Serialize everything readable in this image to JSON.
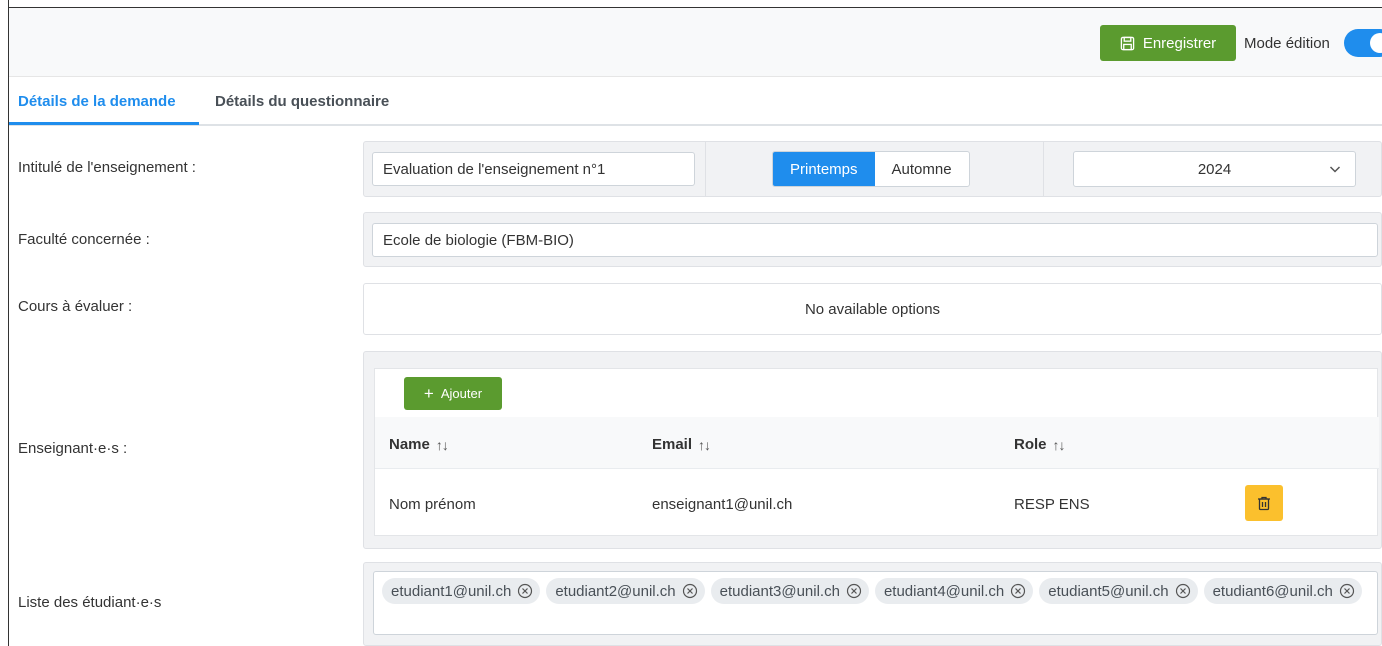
{
  "toolbar": {
    "save_label": "Enregistrer",
    "mode_label": "Mode édition",
    "mode_enabled": true,
    "save_icon": "floppy-disk-icon"
  },
  "tabs": [
    {
      "label": "Détails de la demande",
      "active": true
    },
    {
      "label": "Détails du questionnaire",
      "active": false
    }
  ],
  "form": {
    "intitule": {
      "label": "Intitulé de l'enseignement :",
      "value": "Evaluation de l'enseignement n°1",
      "semester_options": [
        "Printemps",
        "Automne"
      ],
      "semester_selected": "Printemps",
      "year": "2024"
    },
    "faculte": {
      "label": "Faculté concernée :",
      "value": "Ecole de biologie (FBM-BIO)"
    },
    "cours": {
      "label": "Cours à évaluer :",
      "empty_text": "No available options"
    },
    "enseignants": {
      "label": "Enseignant·e·s :",
      "add_label": "Ajouter",
      "columns": [
        "Name",
        "Email",
        "Role"
      ],
      "sort_glyph": "↑↓",
      "rows": [
        {
          "name": "Nom prénom",
          "email": "enseignant1@unil.ch",
          "role": "RESP ENS"
        }
      ]
    },
    "etudiants": {
      "label": "Liste des étudiant·e·s",
      "emails": [
        "etudiant1@unil.ch",
        "etudiant2@unil.ch",
        "etudiant3@unil.ch",
        "etudiant4@unil.ch",
        "etudiant5@unil.ch",
        "etudiant6@unil.ch"
      ]
    }
  },
  "colors": {
    "primary": "#1f8ded",
    "success": "#5b9b2f",
    "warning": "#fbc02d"
  }
}
